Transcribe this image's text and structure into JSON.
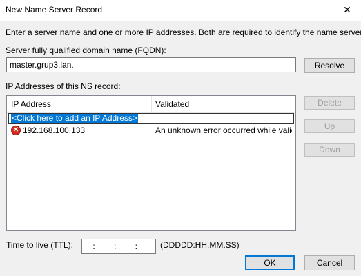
{
  "window": {
    "title": "New Name Server Record",
    "close_glyph": "✕"
  },
  "instructions": "Enter a server name and one or more IP addresses.  Both are required to identify the name server.",
  "fqdn": {
    "label": "Server fully qualified domain name (FQDN):",
    "value": "master.grup3.lan.",
    "resolve_label": "Resolve"
  },
  "ip_section": {
    "label": "IP Addresses of this NS record:",
    "columns": [
      "IP Address",
      "Validated"
    ],
    "add_placeholder": "<Click here to add an IP Address>",
    "rows": [
      {
        "ip": "192.168.100.133",
        "validated": "An unknown error occurred while valid…",
        "status_icon": "error-icon"
      }
    ],
    "buttons": {
      "delete": "Delete",
      "up": "Up",
      "down": "Down"
    }
  },
  "ttl": {
    "label": "Time to live (TTL):",
    "value": ": : :",
    "format": "(DDDDD:HH.MM.SS)"
  },
  "footer": {
    "ok_label": "OK",
    "cancel_label": "Cancel"
  }
}
